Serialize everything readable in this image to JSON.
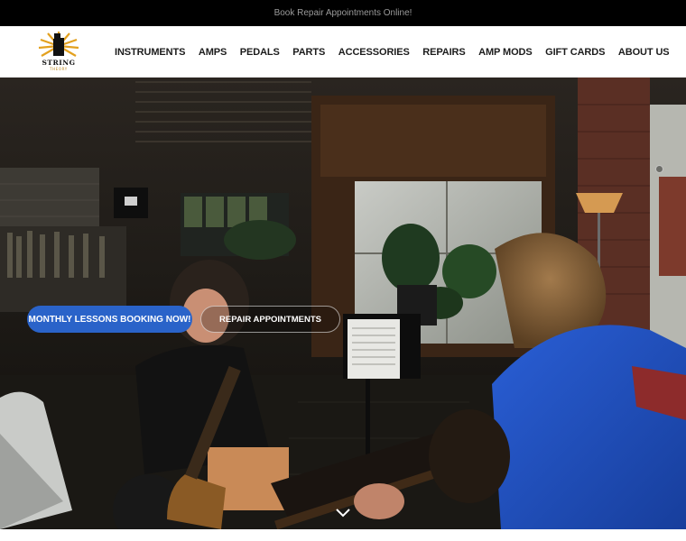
{
  "announcement": {
    "text": "Book Repair Appointments Online!"
  },
  "brand": {
    "name": "STRING",
    "sub": "THEORY",
    "colors": {
      "gold": "#e3a11f",
      "dark": "#111111"
    }
  },
  "nav": {
    "items": [
      {
        "label": "INSTRUMENTS"
      },
      {
        "label": "AMPS"
      },
      {
        "label": "PEDALS"
      },
      {
        "label": "PARTS"
      },
      {
        "label": "ACCESSORIES"
      },
      {
        "label": "REPAIRS"
      },
      {
        "label": "AMP MODS"
      },
      {
        "label": "GIFT CARDS"
      },
      {
        "label": "ABOUT US"
      }
    ]
  },
  "hero": {
    "primary_button": "MONTHLY LESSONS BOOKING NOW!",
    "secondary_button": "REPAIR APPOINTMENTS",
    "scroll_icon": "chevron-down-icon",
    "colors": {
      "primary": "#2a63c9",
      "shirt": "#1f52c8"
    }
  }
}
